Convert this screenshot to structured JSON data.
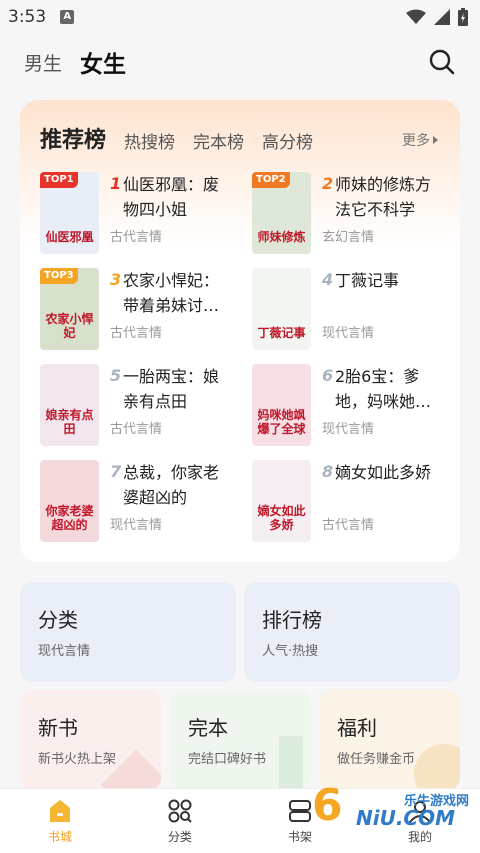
{
  "status_bar": {
    "time": "3:53",
    "sim_label": "A"
  },
  "top_tabs": [
    {
      "label": "男生",
      "active": false
    },
    {
      "label": "女生",
      "active": true
    }
  ],
  "rank_card": {
    "title": "推荐榜",
    "sub_tabs": [
      "热搜榜",
      "完本榜",
      "高分榜"
    ],
    "more_label": "更多",
    "books": [
      {
        "rank": "1",
        "name": "仙医邪凰：废物四小姐",
        "genre": "古代言情",
        "badge": "TOP1",
        "cover_text": "仙医邪凰",
        "rank_color": "#e8332a",
        "badge_color": "#e8332a",
        "cover_bg": "#e9eef6"
      },
      {
        "rank": "2",
        "name": "师妹的修炼方法它不科学",
        "genre": "玄幻言情",
        "badge": "TOP2",
        "cover_text": "师妹修炼",
        "rank_color": "#f07a23",
        "badge_color": "#f07a23",
        "cover_bg": "#dfe8d8"
      },
      {
        "rank": "3",
        "name": "农家小悍妃：带着弟妹讨…",
        "genre": "古代言情",
        "badge": "TOP3",
        "cover_text": "农家小悍妃",
        "rank_color": "#f4a623",
        "badge_color": "#f4a623",
        "cover_bg": "#d7e0cb"
      },
      {
        "rank": "4",
        "name": "丁薇记事",
        "genre": "现代言情",
        "badge": "",
        "cover_text": "丁薇记事",
        "rank_color": "#a9b3c1",
        "badge_color": "",
        "cover_bg": "#f3f5f2"
      },
      {
        "rank": "5",
        "name": "一胎两宝：娘亲有点田",
        "genre": "古代言情",
        "badge": "",
        "cover_text": "娘亲有点田",
        "rank_color": "#a9b3c1",
        "badge_color": "",
        "cover_bg": "#f1e6ee"
      },
      {
        "rank": "6",
        "name": "2胎6宝：爹地，妈咪她…",
        "genre": "现代言情",
        "badge": "",
        "cover_text": "妈咪她飒爆了全球",
        "rank_color": "#a9b3c1",
        "badge_color": "",
        "cover_bg": "#f7dfe6"
      },
      {
        "rank": "7",
        "name": "总裁，你家老婆超凶的",
        "genre": "现代言情",
        "badge": "",
        "cover_text": "你家老婆超凶的",
        "rank_color": "#a9b3c1",
        "badge_color": "",
        "cover_bg": "#f3d9dc"
      },
      {
        "rank": "8",
        "name": "嫡女如此多娇",
        "genre": "古代言情",
        "badge": "",
        "cover_text": "嫡女如此多娇",
        "rank_color": "#a9b3c1",
        "badge_color": "",
        "cover_bg": "#f4eef3"
      }
    ]
  },
  "tiles": [
    {
      "title": "分类",
      "sub": "现代言情",
      "bg": "#e9eef7"
    },
    {
      "title": "排行榜",
      "sub": "人气·热搜",
      "bg": "#e9eef7"
    },
    {
      "title": "新书",
      "sub": "新书火热上架",
      "bg": "#fbefee"
    },
    {
      "title": "完本",
      "sub": "完结口碑好书",
      "bg": "#eef6ee"
    },
    {
      "title": "福利",
      "sub": "做任务赚金币",
      "bg": "#fbf3e6"
    }
  ],
  "bottom_nav": [
    {
      "label": "书城",
      "icon": "bookstore-icon",
      "active": true
    },
    {
      "label": "分类",
      "icon": "category-icon",
      "active": false
    },
    {
      "label": "书架",
      "icon": "bookshelf-icon",
      "active": false
    },
    {
      "label": "我的",
      "icon": "profile-icon",
      "active": false
    }
  ],
  "watermark": {
    "brand_top": "乐牛游戏网",
    "brand_bottom": "NiU.COM",
    "digit": "6"
  },
  "colors": {
    "accent": "#f0a020",
    "card_gradient_top": "#fde3cf"
  }
}
